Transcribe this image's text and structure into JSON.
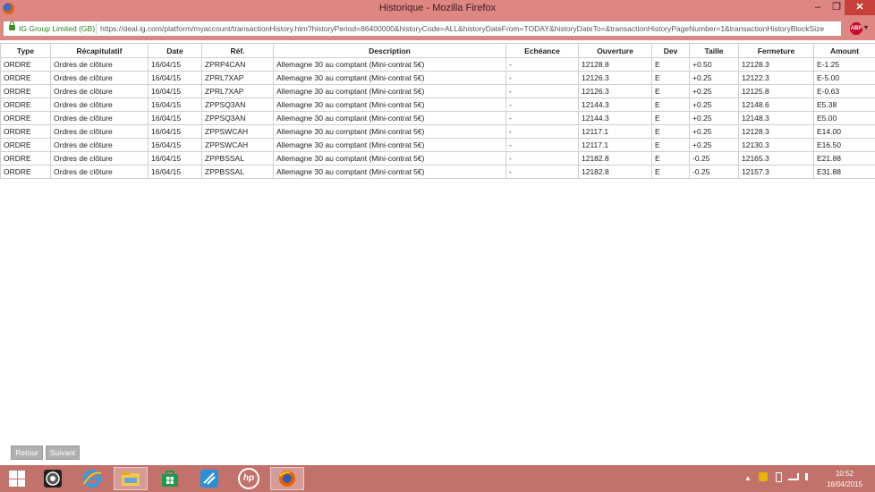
{
  "window": {
    "title": "Historique - Mozilla Firefox",
    "min_symbol": "–",
    "max_symbol": "❐",
    "close_symbol": "✕"
  },
  "address_bar": {
    "site_identity": "IG Group Limited (GB)",
    "url": "https://deal.ig.com/platform/myaccount/transactionHistory.htm?historyPeriod=86400000&historyCode=ALL&historyDateFrom=TODAY&historyDateTo=&transactionHistoryPageNumber=1&transactionHistoryBlockSize",
    "addon_label": "ABP"
  },
  "table": {
    "headers": [
      "Type",
      "Récapitulatif",
      "Date",
      "Réf.",
      "Description",
      "Echéance",
      "Ouverture",
      "Dev",
      "Taille",
      "Fermeture",
      "Amount"
    ],
    "rows": [
      [
        "ORDRE",
        "Ordres de clôture",
        "16/04/15",
        "ZPRP4CAN",
        "Allemagne 30 au comptant (Mini-contrat 5€)",
        "-",
        "12128.8",
        "E",
        "+0.50",
        "12128.3",
        "E-1.25"
      ],
      [
        "ORDRE",
        "Ordres de clôture",
        "16/04/15",
        "ZPRL7XAP",
        "Allemagne 30 au comptant (Mini-contrat 5€)",
        "-",
        "12126.3",
        "E",
        "+0.25",
        "12122.3",
        "E-5.00"
      ],
      [
        "ORDRE",
        "Ordres de clôture",
        "16/04/15",
        "ZPRL7XAP",
        "Allemagne 30 au comptant (Mini-contrat 5€)",
        "-",
        "12126.3",
        "E",
        "+0.25",
        "12125.8",
        "E-0.63"
      ],
      [
        "ORDRE",
        "Ordres de clôture",
        "16/04/15",
        "ZPPSQ3AN",
        "Allemagne 30 au comptant (Mini-contrat 5€)",
        "-",
        "12144.3",
        "E",
        "+0.25",
        "12148.6",
        "E5.38"
      ],
      [
        "ORDRE",
        "Ordres de clôture",
        "16/04/15",
        "ZPPSQ3AN",
        "Allemagne 30 au comptant (Mini-contrat 5€)",
        "-",
        "12144.3",
        "E",
        "+0.25",
        "12148.3",
        "E5.00"
      ],
      [
        "ORDRE",
        "Ordres de clôture",
        "16/04/15",
        "ZPPSWCAH",
        "Allemagne 30 au comptant (Mini-contrat 5€)",
        "-",
        "12117.1",
        "E",
        "+0.25",
        "12128.3",
        "E14.00"
      ],
      [
        "ORDRE",
        "Ordres de clôture",
        "16/04/15",
        "ZPPSWCAH",
        "Allemagne 30 au comptant (Mini-contrat 5€)",
        "-",
        "12117.1",
        "E",
        "+0.25",
        "12130.3",
        "E16.50"
      ],
      [
        "ORDRE",
        "Ordres de clôture",
        "16/04/15",
        "ZPPBSSAL",
        "Allemagne 30 au comptant (Mini-contrat 5€)",
        "-",
        "12182.8",
        "E",
        "-0.25",
        "12165.3",
        "E21.88"
      ],
      [
        "ORDRE",
        "Ordres de clôture",
        "16/04/15",
        "ZPPBSSAL",
        "Allemagne 30 au comptant (Mini-contrat 5€)",
        "-",
        "12182.8",
        "E",
        "-0.25",
        "12157.3",
        "E31.88"
      ]
    ]
  },
  "buttons": {
    "back": "Retour",
    "next": "Suivant"
  },
  "taskbar": {
    "items": [
      "start-icon",
      "media-player-icon",
      "internet-explorer-icon",
      "file-explorer-icon",
      "windows-store-icon",
      "app-icon",
      "hp-icon",
      "firefox-icon"
    ],
    "hp_label": "hp",
    "time": "10:52",
    "date": "16/04/2015",
    "tray_arrow": "▲"
  },
  "colors": {
    "titlebar": "#dd8682",
    "taskbar": "#c2726b",
    "close_button": "#c7413a"
  }
}
